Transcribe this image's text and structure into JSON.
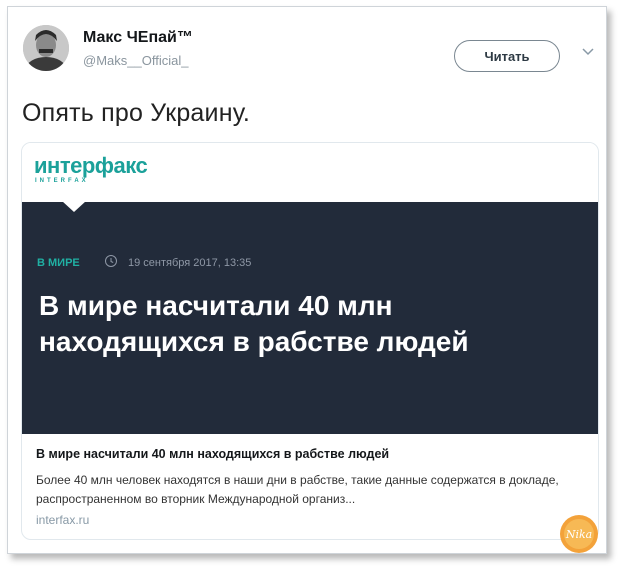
{
  "tweet": {
    "author_name": "Макс ЧЕпай™",
    "author_handle": "@Maks__Official_",
    "follow_label": "Читать",
    "text": "Опять про Украину."
  },
  "card": {
    "logo": "интерфакс",
    "logo_sub": "INTERFAX",
    "category": "В МИРЕ",
    "date": "19 сентября 2017, 13:35",
    "headline": "В мире насчитали 40 млн находящихся в рабстве людей",
    "title": "В мире насчитали 40 млн находящихся в рабстве людей",
    "description": "Более 40 млн человек находятся в наши дни в рабстве, такие данные содержатся в докладе, распространенном во вторник Международной организ...",
    "domain": "interfax.ru"
  },
  "watermark": {
    "text": "Nika"
  },
  "colors": {
    "accent_teal": "#1ba19a",
    "dark_bg": "#222b3a"
  }
}
